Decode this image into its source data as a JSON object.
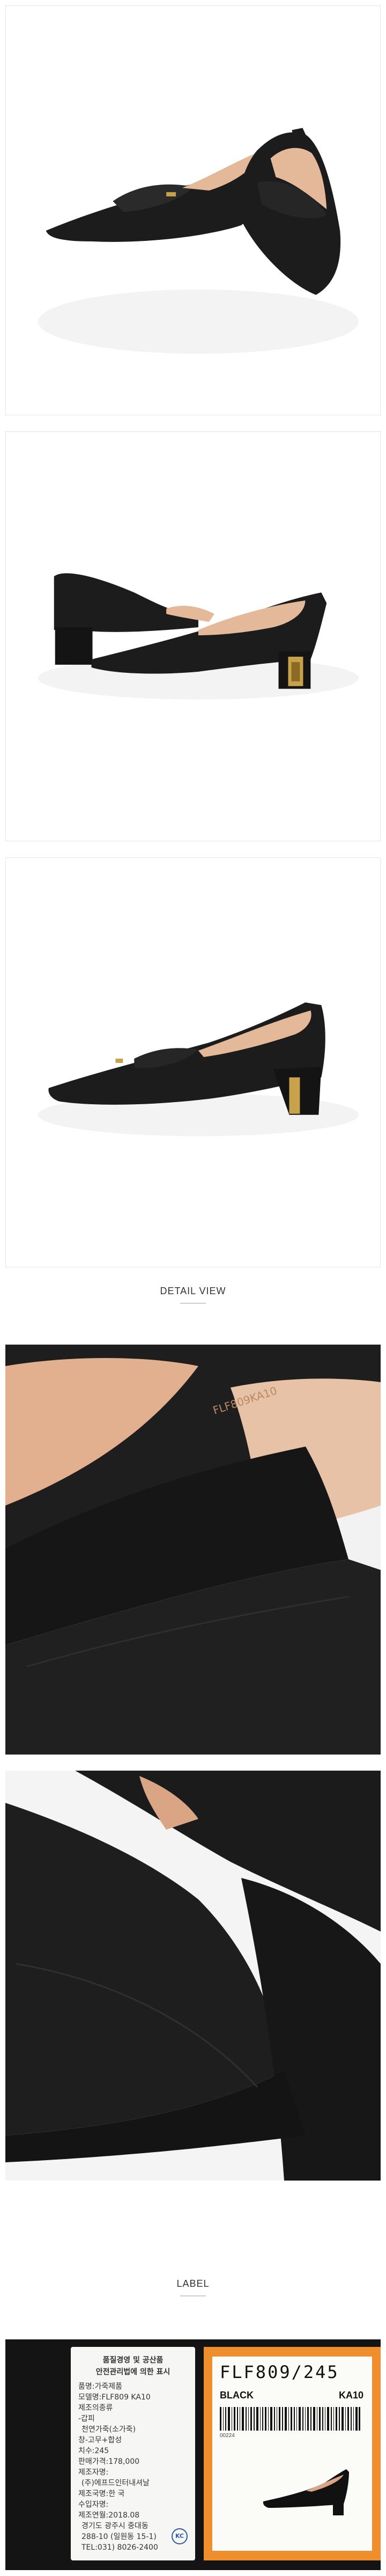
{
  "sections": {
    "detail_title": "DETAIL VIEW",
    "label_title": "LABEL"
  },
  "label": {
    "care_heading_1": "품질경영 및 공산품",
    "care_heading_2": "안전관리법에 의한 표시",
    "lines": [
      "품명:가죽제품",
      "모델명:FLF809 KA10",
      "제조의종류",
      " -갑피",
      "   천연가죽(소가죽)",
      "창-고무+합성",
      "치수:245",
      "판매가격:178,000",
      "제조자명:",
      "  (주)에프드인터내셔날",
      "제조국명:한 국",
      "수입자명:",
      "제조연월:2018.08",
      "  경기도 광주시 중대동",
      "  288-10 (일원동 15-1)",
      "  TEL:031) 8026-2400"
    ],
    "kc_mark": "KC",
    "style_code": "FLF809/245",
    "color": "BLACK",
    "size_code": "KA10",
    "barcode_number": "00224"
  },
  "colors": {
    "leather": "#1c1c1c",
    "lining": "#e4b99a",
    "gold_heel": "#c8a24a",
    "orange_tag": "#ef8e2c"
  }
}
